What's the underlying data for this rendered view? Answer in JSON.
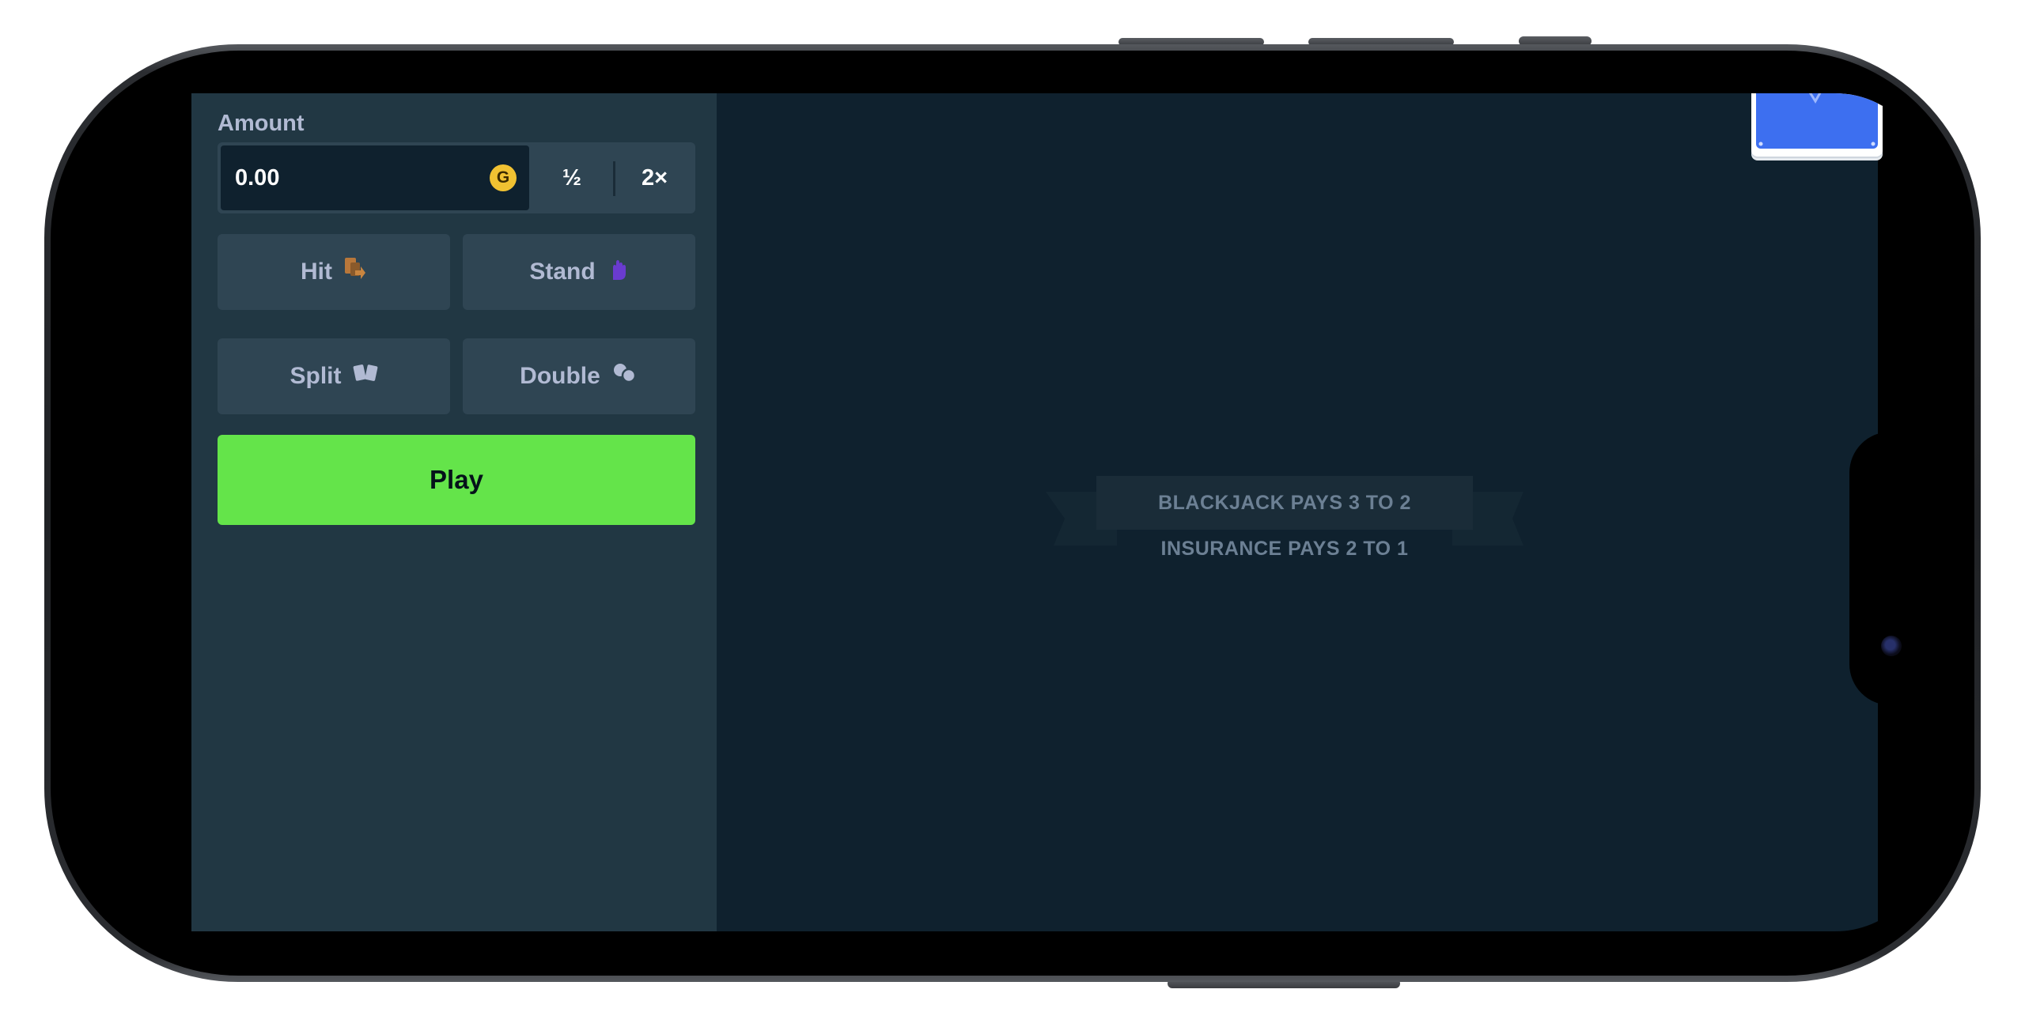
{
  "bet": {
    "amount_label": "Amount",
    "amount_value": "0.00",
    "currency_symbol": "G",
    "half_label": "½",
    "double_label": "2×"
  },
  "actions": {
    "hit": "Hit",
    "stand": "Stand",
    "split": "Split",
    "double": "Double",
    "play": "Play"
  },
  "table": {
    "blackjack_text": "BLACKJACK PAYS 3 TO 2",
    "insurance_text": "INSURANCE PAYS 2 TO 1"
  },
  "colors": {
    "play_button": "#64e44a",
    "sidebar": "#213743",
    "table": "#0f212e",
    "card_back": "#3d6ff0",
    "coin": "#f1c232",
    "hit_icon": "#b8773a",
    "stand_icon": "#6a3bd0"
  },
  "icons": {
    "currency": "coin-icon",
    "hit": "hit-icon",
    "stand": "stand-icon",
    "split": "split-icon",
    "double": "double-icon",
    "deck": "card-deck-icon"
  }
}
